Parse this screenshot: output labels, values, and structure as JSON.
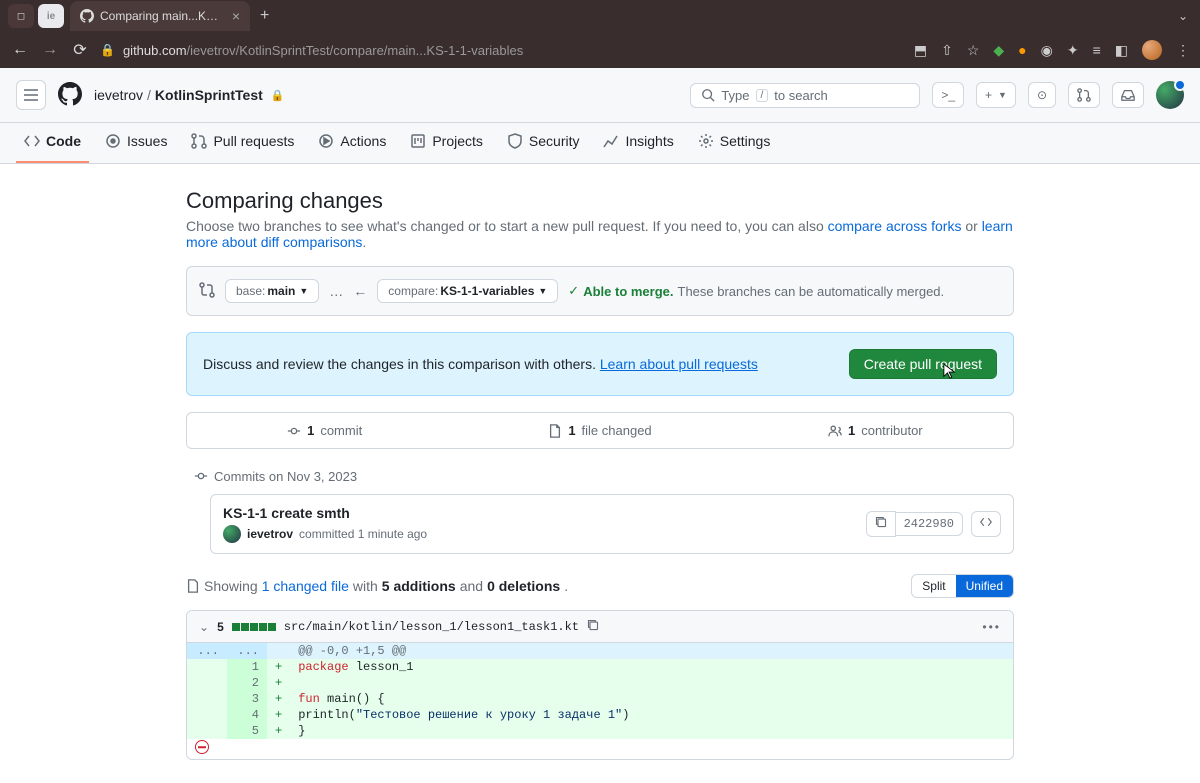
{
  "browser": {
    "tab_title": "Comparing main...KS-1-1-var",
    "url_host": "github.com",
    "url_path": "/ievetrov/KotlinSprintTest/compare/main...KS-1-1-variables"
  },
  "header": {
    "owner": "ievetrov",
    "repo": "KotlinSprintTest",
    "search_prefix": "Type",
    "search_key": "/",
    "search_suffix": "to search"
  },
  "nav": {
    "code": "Code",
    "issues": "Issues",
    "pull_requests": "Pull requests",
    "actions": "Actions",
    "projects": "Projects",
    "security": "Security",
    "insights": "Insights",
    "settings": "Settings"
  },
  "page": {
    "title": "Comparing changes",
    "subtitle_pre": "Choose two branches to see what's changed or to start a new pull request. If you need to, you can also ",
    "subtitle_link1": "compare across forks",
    "subtitle_mid": " or ",
    "subtitle_link2": "learn more about diff comparisons",
    "subtitle_end": "."
  },
  "compare": {
    "base_label": "base:",
    "base_value": "main",
    "compare_label": "compare:",
    "compare_value": "KS-1-1-variables",
    "merge_able": "Able to merge.",
    "merge_rest": "These branches can be automatically merged."
  },
  "prompt": {
    "text": "Discuss and review the changes in this comparison with others. ",
    "link": "Learn about pull requests",
    "button": "Create pull request"
  },
  "stats": {
    "commits_n": "1",
    "commits_lbl": "commit",
    "files_n": "1",
    "files_lbl": "file changed",
    "contrib_n": "1",
    "contrib_lbl": "contributor"
  },
  "commits": {
    "date_label": "Commits on Nov 3, 2023",
    "title": "KS-1-1 create smth",
    "author": "ievetrov",
    "meta_rest": "committed 1 minute ago",
    "sha": "2422980"
  },
  "diff": {
    "showing": "Showing",
    "changed_link": "1 changed file",
    "with": "with",
    "additions": "5 additions",
    "and": "and",
    "deletions": "0 deletions",
    "view_split": "Split",
    "view_unified": "Unified",
    "stat_num": "5",
    "filename": "src/main/kotlin/lesson_1/lesson1_task1.kt",
    "hunk": "@@ -0,0 +1,5 @@",
    "lines": {
      "l1": "package",
      "l1b": " lesson_1",
      "l3a": "fun",
      "l3b": " main() {",
      "l4a": "    println(",
      "l4b": "\"Тестовое решение к уроку 1 задаче 1\"",
      "l4c": ")",
      "l5": "}"
    }
  }
}
